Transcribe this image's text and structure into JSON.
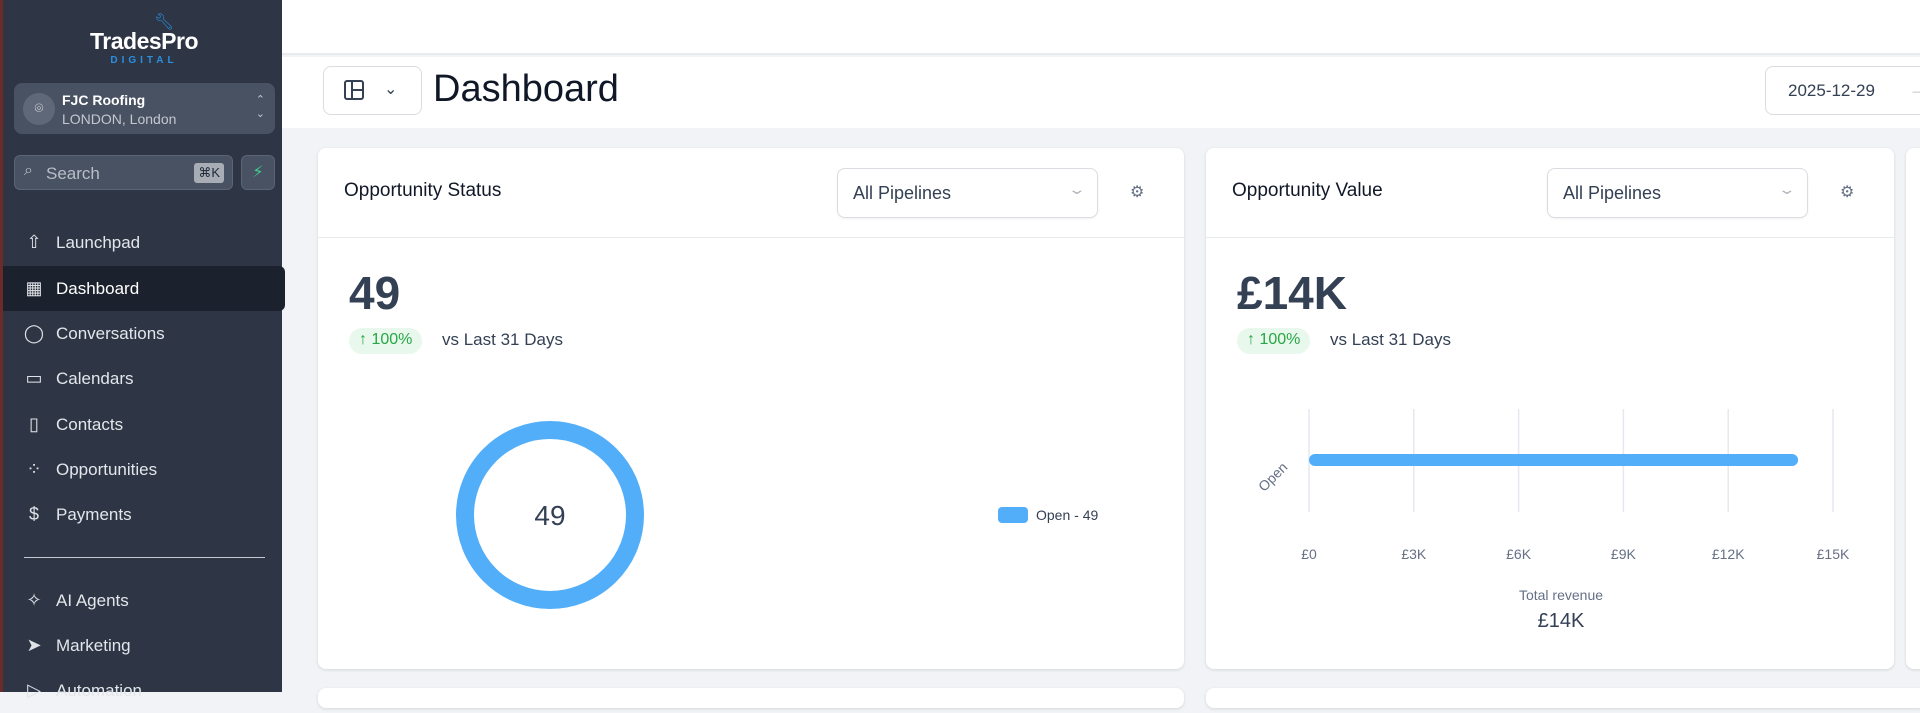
{
  "brand": {
    "name": "TradesPro",
    "sub": "DIGITAL"
  },
  "location": {
    "name": "FJC Roofing",
    "sub": "LONDON, London"
  },
  "search": {
    "placeholder": "Search",
    "shortcut": "⌘K"
  },
  "nav": [
    {
      "label": "Launchpad",
      "icon": "rocket-icon",
      "glyph": "⇧"
    },
    {
      "label": "Dashboard",
      "icon": "dashboard-icon",
      "glyph": "▦",
      "active": true
    },
    {
      "label": "Conversations",
      "icon": "chat-bubble-icon",
      "glyph": "◯"
    },
    {
      "label": "Calendars",
      "icon": "calendar-icon",
      "glyph": "▭"
    },
    {
      "label": "Contacts",
      "icon": "contacts-book-icon",
      "glyph": "▯"
    },
    {
      "label": "Opportunities",
      "icon": "opportunities-icon",
      "glyph": "⁘"
    },
    {
      "label": "Payments",
      "icon": "payments-icon",
      "glyph": "$"
    },
    {
      "label": "AI Agents",
      "icon": "sparkle-icon",
      "glyph": "✧"
    },
    {
      "label": "Marketing",
      "icon": "send-icon",
      "glyph": "➤"
    },
    {
      "label": "Automation",
      "icon": "automation-icon",
      "glyph": "▷"
    }
  ],
  "header": {
    "title": "Dashboard",
    "date": "2025-12-29"
  },
  "cards": {
    "status": {
      "title": "Opportunity Status",
      "filter": "All Pipelines",
      "value": "49",
      "change": "↑ 100%",
      "compare": "vs Last 31 Days"
    },
    "value": {
      "title": "Opportunity Value",
      "filter": "All Pipelines",
      "value": "£14K",
      "change": "↑ 100%",
      "compare": "vs Last 31 Days"
    }
  },
  "colors": {
    "series": "#53aef9",
    "sidebar": "#2e3646",
    "positive": "#27a745"
  },
  "chart_data": [
    {
      "type": "pie",
      "variant": "donut",
      "center_label": "49",
      "slices": [
        {
          "label": "Open",
          "value": 49,
          "legend": "Open - 49"
        }
      ],
      "legend_position": "right"
    },
    {
      "type": "bar",
      "orientation": "horizontal",
      "categories": [
        "Open"
      ],
      "values": [
        14000
      ],
      "xlim": [
        0,
        15000
      ],
      "xticks": [
        "£0",
        "£3K",
        "£6K",
        "£9K",
        "£12K",
        "£15K"
      ],
      "xlabel": "Total revenue",
      "total": "£14K",
      "grid": true
    }
  ]
}
